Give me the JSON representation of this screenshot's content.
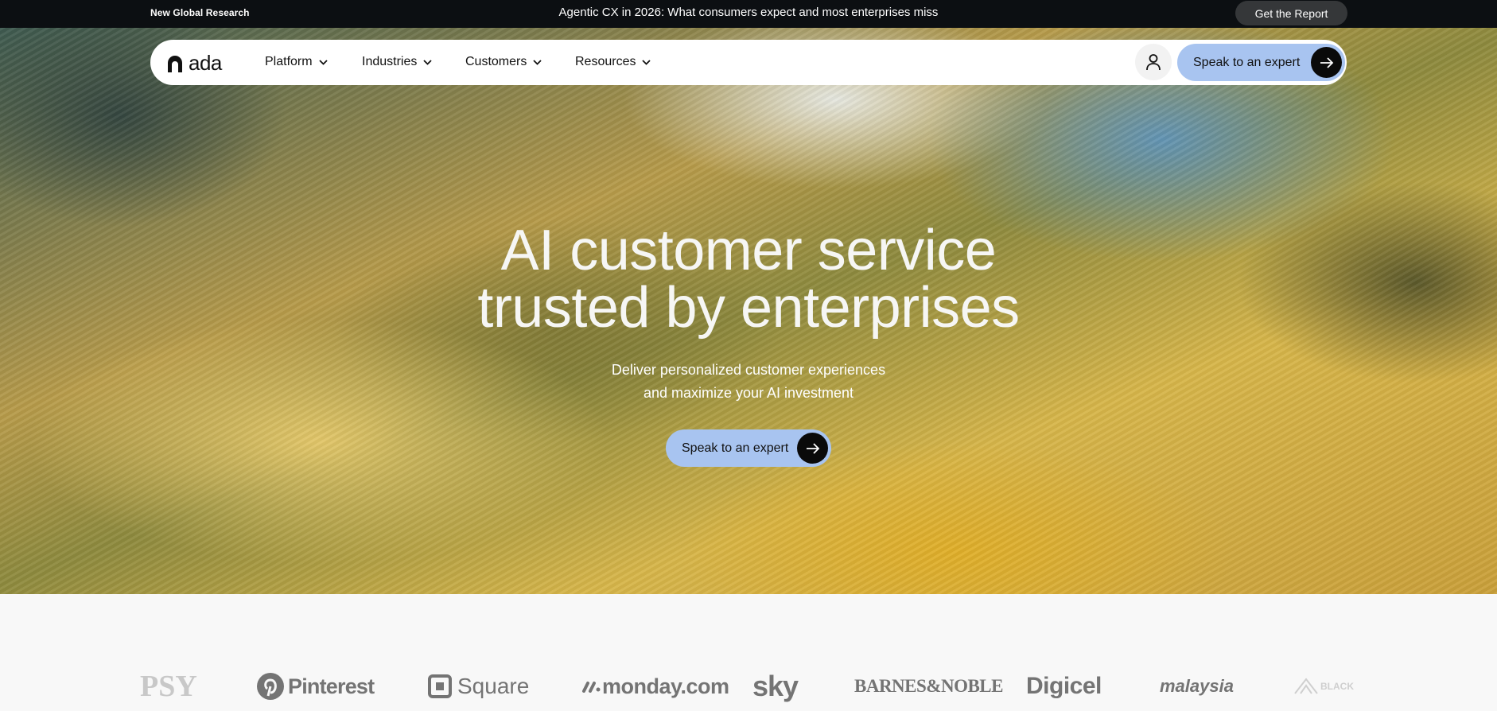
{
  "topbar": {
    "tag": "New Global Research",
    "headline": "Agentic CX in 2026: What consumers expect and most enterprises miss",
    "cta": "Get the Report"
  },
  "nav": {
    "logo": "ada",
    "items": [
      {
        "label": "Platform"
      },
      {
        "label": "Industries"
      },
      {
        "label": "Customers"
      },
      {
        "label": "Resources"
      }
    ],
    "user_icon": "user-icon",
    "cta": "Speak to an expert"
  },
  "hero": {
    "title_line1": "AI customer service",
    "title_line2": "trusted by enterprises",
    "subtitle_line1": "Deliver personalized customer experiences",
    "subtitle_line2": "and maximize your AI investment",
    "cta": "Speak to an expert"
  },
  "logos": {
    "items": [
      "PSY",
      "Pinterest",
      "Square",
      "monday.com",
      "sky",
      "BARNES&NOBLE",
      "Digicel",
      "malaysia",
      "BLACK"
    ]
  },
  "colors": {
    "topbar_bg": "#0c0f12",
    "cta_bg": "#a8c4f0",
    "arrow_bg": "#0a0a0a"
  }
}
